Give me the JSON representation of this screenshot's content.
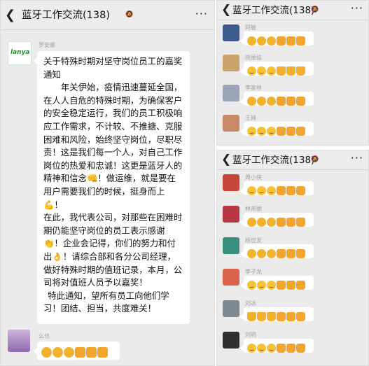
{
  "chat_title": "蓝牙工作交流(138)",
  "icons": {
    "back": "chevron-left-icon",
    "mute": "bell-off-icon",
    "more": "more-dots-icon"
  },
  "left_panel": {
    "post_sender": "罗安娜",
    "post_title": "关于特殊时期对坚守岗位员工的嘉奖通知",
    "post_paragraphs": [
      "年关伊始，疫情迅速蔓延全国，在人人自危的特殊时期，为确保客户的安全稳定运行，我们的员工积极响应工作需求，不计较、不推搪、克服困难和风险，始终坚守岗位，尽职尽责！这是我们每一个人，对自己工作岗位的热爱和忠诚！这更是蓝牙人的精神和信念👊！做运维，就是要在用户需要我们的时候，挺身而上💪！",
      "在此，我代表公司，对那些在困难时期仍能坚守岗位的员工表示感谢👏！企业会记得，你们的努力和付出👌！请综合部和各分公司经理，做好特殊时期的值班记录，本月，公司将对值班人员予以嘉奖！",
      "特此通知，望所有员工向他们学习！团结、担当，共度难关！"
    ],
    "reply_sender": "么也",
    "reply_emojis": [
      "clap",
      "clap",
      "clap",
      "fist",
      "fist",
      "fist"
    ]
  },
  "top_right": {
    "messages": [
      {
        "sender": "阿敏",
        "emojis": [
          "clap",
          "clap",
          "clap",
          "fist",
          "fist",
          "fist"
        ]
      },
      {
        "sender": "晓丽娃",
        "emojis": [
          "face",
          "face",
          "face",
          "thumb",
          "thumb",
          "thumb"
        ]
      },
      {
        "sender": "李家林",
        "emojis": [
          "clap",
          "clap",
          "clap",
          "fist",
          "fist",
          "fist"
        ]
      },
      {
        "sender": "王妹",
        "emojis": [
          "face",
          "face",
          "face",
          "fist",
          "fist",
          "fist"
        ]
      }
    ]
  },
  "bottom_right": {
    "messages": [
      {
        "sender": "周小侠",
        "emojis": [
          "face",
          "face",
          "face",
          "fist",
          "fist",
          "fist"
        ]
      },
      {
        "sender": "林燕丽",
        "emojis": [
          "clap",
          "clap",
          "clap",
          "fist",
          "fist",
          "fist"
        ]
      },
      {
        "sender": "杨世友",
        "emojis": [
          "clap",
          "clap",
          "clap",
          "fist",
          "fist",
          "fist"
        ]
      },
      {
        "sender": "李子龙",
        "emojis": [
          "face",
          "face",
          "face",
          "fist",
          "fist",
          "fist"
        ]
      },
      {
        "sender": "刘冰",
        "emojis": [
          "thumb",
          "thumb",
          "thumb",
          "fist",
          "fist",
          "fist"
        ]
      },
      {
        "sender": "刘明",
        "emojis": [
          "face",
          "face",
          "face",
          "fist",
          "fist",
          "fist"
        ]
      }
    ]
  }
}
